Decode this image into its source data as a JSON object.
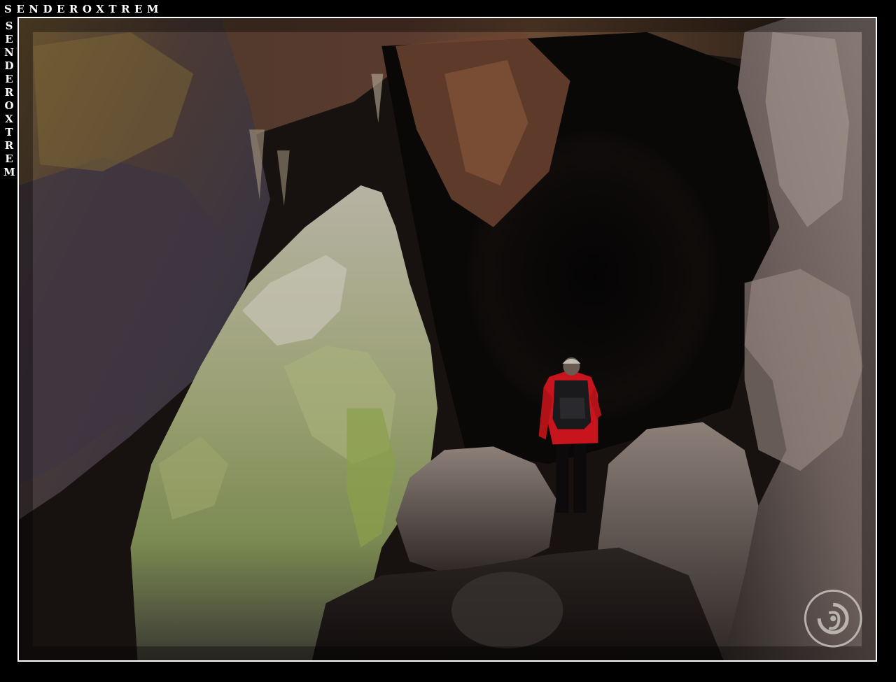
{
  "watermark": {
    "top_text": "SENDEROXTREM",
    "side_text": "SENDEROXTREM"
  },
  "photo": {
    "subject": "cave-interior-with-hiker",
    "colors": {
      "frame": "#000000",
      "border": "#ffffff",
      "jacket": "#c8141c",
      "moss": "#8fa35a"
    }
  },
  "logo": {
    "icon": "senderoxtrem-logo-icon"
  }
}
